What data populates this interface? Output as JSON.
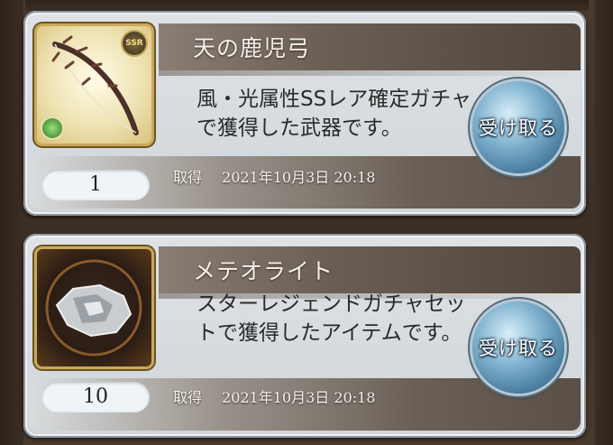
{
  "items": [
    {
      "name": "天の鹿児弓",
      "description": "風・光属性SSレア確定ガチャで獲得した武器です。",
      "quantity": "1",
      "acquired_label": "取得",
      "acquired_date": "2021年10月3日 20:18",
      "receive_label": "受け取る",
      "rarity_badge": "SSR",
      "thumbnail_icon": "bow-icon",
      "element_icon": "wind-element-icon"
    },
    {
      "name": "メテオライト",
      "description": "スターレジェンドガチャセットで獲得したアイテムです。",
      "quantity": "10",
      "acquired_label": "取得",
      "acquired_date": "2021年10月3日 20:18",
      "receive_label": "受け取る",
      "thumbnail_icon": "meteorite-icon"
    }
  ],
  "colors": {
    "background": "#3c2f25",
    "card": "#d8dde0",
    "button": "#5f93b3"
  }
}
